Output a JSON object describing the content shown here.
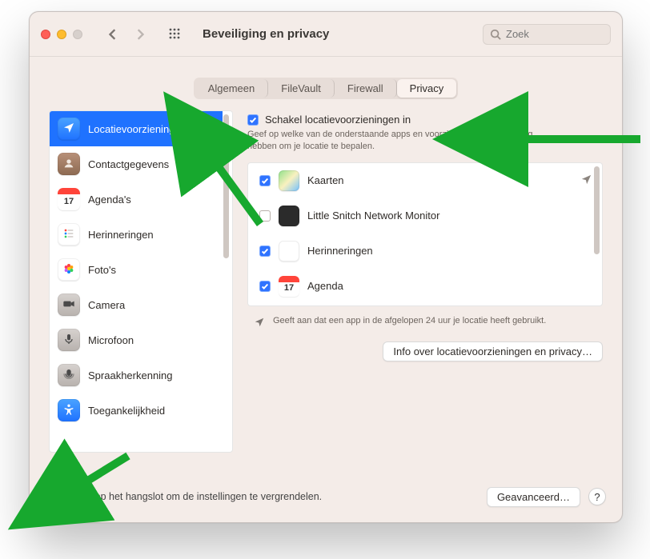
{
  "window": {
    "title": "Beveiliging en privacy"
  },
  "search": {
    "placeholder": "Zoek"
  },
  "tabs": [
    "Algemeen",
    "FileVault",
    "Firewall",
    "Privacy"
  ],
  "active_tab_index": 3,
  "sidebar": {
    "items": [
      {
        "label": "Locatievoorzieningen",
        "icon": "location",
        "selected": true
      },
      {
        "label": "Contactgegevens",
        "icon": "contacts"
      },
      {
        "label": "Agenda's",
        "icon": "calendar",
        "badge": "17"
      },
      {
        "label": "Herinneringen",
        "icon": "reminders"
      },
      {
        "label": "Foto's",
        "icon": "photos"
      },
      {
        "label": "Camera",
        "icon": "camera"
      },
      {
        "label": "Microfoon",
        "icon": "microphone"
      },
      {
        "label": "Spraakherkenning",
        "icon": "speech"
      },
      {
        "label": "Toegankelijkheid",
        "icon": "accessibility"
      }
    ]
  },
  "main": {
    "toggle_label": "Schakel locatievoorzieningen in",
    "toggle_checked": true,
    "description": "Geef op welke van de onderstaande apps en voorzieningen toestemming hebben om je locatie te bepalen.",
    "apps": [
      {
        "label": "Kaarten",
        "checked": true,
        "recent": true,
        "icon": "maps"
      },
      {
        "label": "Little Snitch Network Monitor",
        "checked": false,
        "recent": false,
        "icon": "littlesnitch"
      },
      {
        "label": "Herinneringen",
        "checked": true,
        "recent": false,
        "icon": "reminders"
      },
      {
        "label": "Agenda",
        "checked": true,
        "recent": false,
        "icon": "calendar",
        "badge": "17"
      }
    ],
    "legend": "Geeft aan dat een app in de afgelopen 24 uur je locatie heeft gebruikt.",
    "info_button": "Info over locatievoorzieningen en privacy…"
  },
  "footer": {
    "lock_text": "Klik op het hangslot om de instellingen te vergrendelen.",
    "advanced_button": "Geavanceerd…",
    "help": "?"
  }
}
